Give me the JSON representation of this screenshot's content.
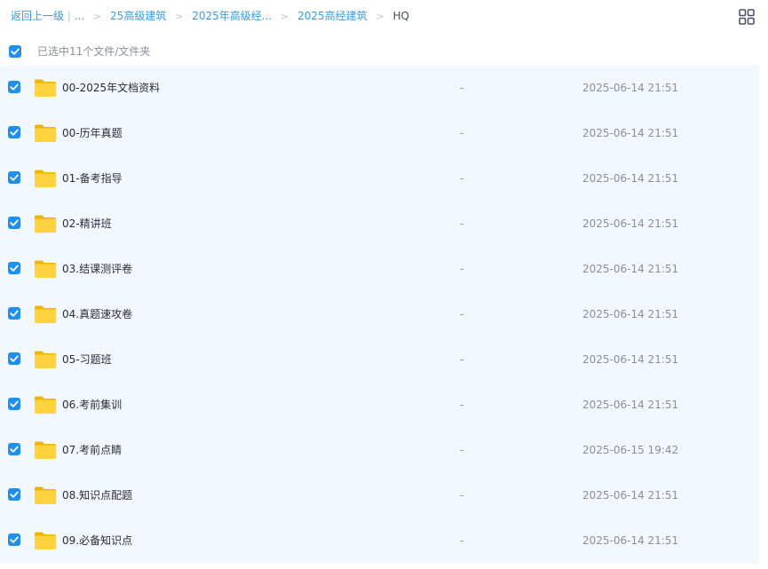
{
  "breadcrumb": {
    "back": "返回上一级",
    "pipe": "|",
    "ellipsis": "...",
    "separator": ">",
    "items": [
      "25高级建筑",
      "2025年高级经...",
      "2025高经建筑"
    ],
    "current": "HQ"
  },
  "selection": {
    "text": "已选中11个文件/文件夹"
  },
  "accent_color": "#1f8ff0",
  "row_background": "#f1f8ff",
  "files": [
    {
      "name": "00-2025年文档资料",
      "size": "-",
      "date": "2025-06-14 21:51"
    },
    {
      "name": "00-历年真题",
      "size": "-",
      "date": "2025-06-14 21:51"
    },
    {
      "name": "01-备考指导",
      "size": "-",
      "date": "2025-06-14 21:51"
    },
    {
      "name": "02-精讲班",
      "size": "-",
      "date": "2025-06-14 21:51"
    },
    {
      "name": "03.结课测评卷",
      "size": "-",
      "date": "2025-06-14 21:51"
    },
    {
      "name": "04.真题速攻卷",
      "size": "-",
      "date": "2025-06-14 21:51"
    },
    {
      "name": "05-习题班",
      "size": "-",
      "date": "2025-06-14 21:51"
    },
    {
      "name": "06.考前集训",
      "size": "-",
      "date": "2025-06-14 21:51"
    },
    {
      "name": "07.考前点睛",
      "size": "-",
      "date": "2025-06-15 19:42"
    },
    {
      "name": "08.知识点配题",
      "size": "-",
      "date": "2025-06-14 21:51"
    },
    {
      "name": "09.必备知识点",
      "size": "-",
      "date": "2025-06-14 21:51"
    }
  ]
}
